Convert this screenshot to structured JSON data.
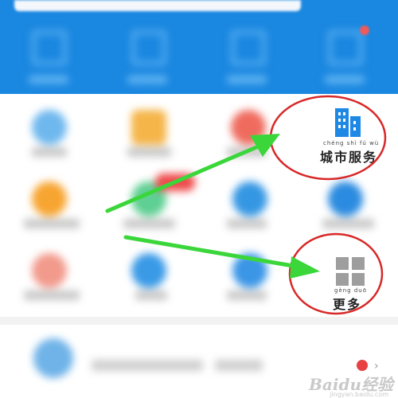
{
  "highlight_1": {
    "label": "城市服务",
    "pinyin": "chéng shì fú wù",
    "icon": "city-buildings-icon"
  },
  "highlight_2": {
    "label": "更多",
    "pinyin": "gèng duō",
    "icon": "four-squares-grid-icon"
  },
  "watermark": {
    "brand": "Baidu经验",
    "sub": "jingyan.baidu.com"
  },
  "colors": {
    "header_blue": "#1a87e0",
    "accent_icon_blue": "#1e88e5",
    "annotation_green": "#3ad63a",
    "annotation_red": "#d82828",
    "grid_icon_gray": "#9e9e9e"
  }
}
